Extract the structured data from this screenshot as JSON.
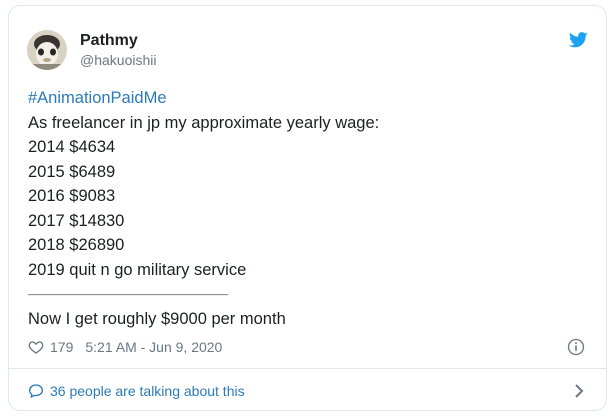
{
  "author": {
    "name": "Pathmy",
    "handle": "@hakuoishii"
  },
  "tweet": {
    "hashtag": "#AnimationPaidMe",
    "lines": [
      "As freelancer in jp my approximate yearly wage:",
      "2014 $4634",
      "2015 $6489",
      "2016 $9083",
      "2017 $14830",
      "2018 $26890",
      "2019 quit n go military service",
      "—————————————————————————",
      "Now I get roughly $9000 per month"
    ]
  },
  "meta": {
    "likes": "179",
    "timestamp": "5:21 AM - Jun 9, 2020"
  },
  "conversation": {
    "label": "36 people are talking about this"
  },
  "icons": {
    "brand": "twitter-bird-icon",
    "like": "heart-icon",
    "info": "info-icon",
    "conversation": "speech-bubble-icon",
    "chevron": "chevron-right-icon"
  },
  "colors": {
    "brand": "#1da1f2",
    "link": "#2b7bb9",
    "text": "#1c2022",
    "muted": "#697882",
    "border": "#e1e8ed"
  }
}
